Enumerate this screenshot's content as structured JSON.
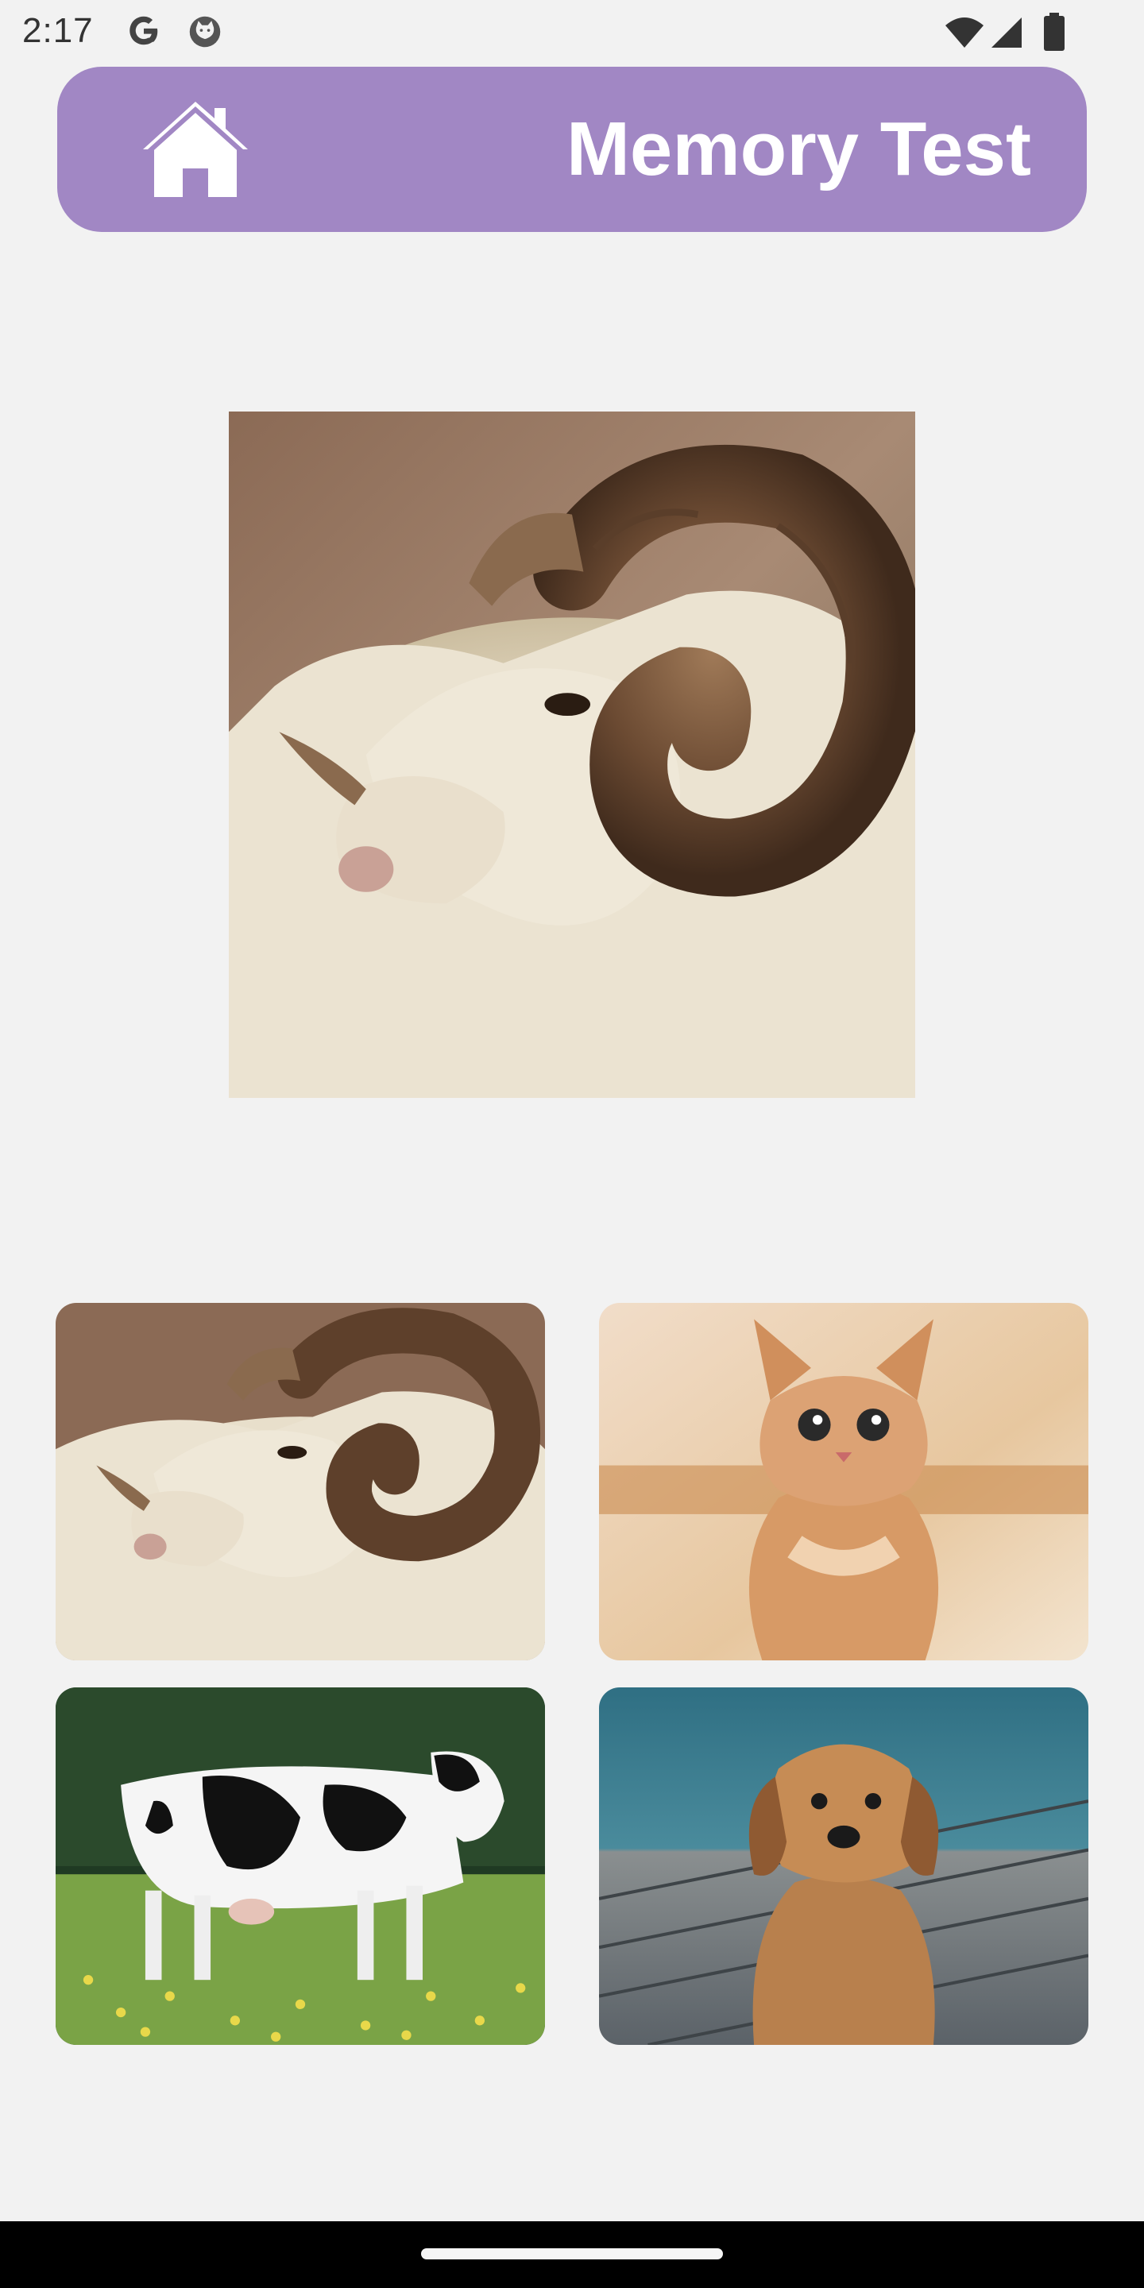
{
  "status_bar": {
    "time": "2:17",
    "icons": [
      "google-icon",
      "cat-notification-icon",
      "wifi-icon",
      "cell-signal-icon",
      "battery-icon"
    ]
  },
  "header": {
    "title": "Memory Test",
    "home_icon": "home-icon",
    "background_color": "#a187c4",
    "title_color": "#ffffff"
  },
  "target": {
    "subject": "ram"
  },
  "choices": [
    {
      "subject": "ram"
    },
    {
      "subject": "kitten"
    },
    {
      "subject": "cow"
    },
    {
      "subject": "puppy"
    }
  ],
  "nav_bar": {
    "handle": "gesture-handle"
  }
}
